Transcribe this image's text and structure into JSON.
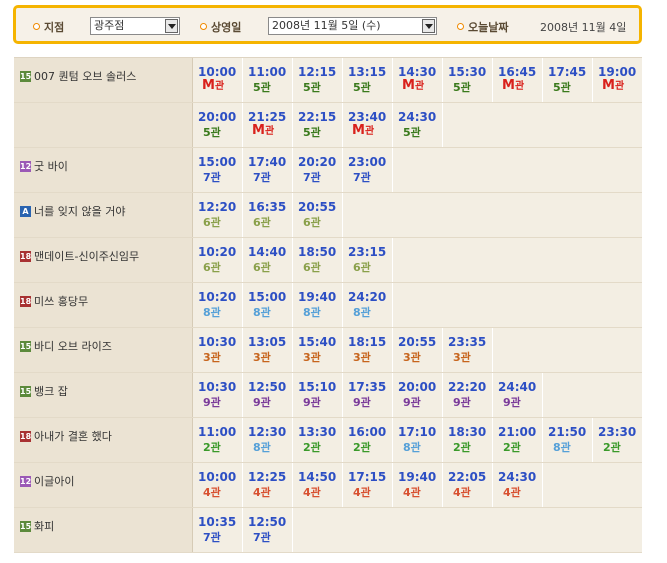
{
  "filters": {
    "branch_label": "지점",
    "branch_value": "광주점",
    "date_label": "상영일",
    "date_value": "2008년 11월 5일 (수)",
    "today_label": "오늘날짜",
    "today_value": "2008년 11월 4일"
  },
  "colors": {
    "rating_15": "#5c8a3c",
    "rating_12": "#9b59b6",
    "rating_all": "#2a64b0",
    "rating_18": "#a83232",
    "hall_M": "#d9211c",
    "hall_2": "#3a9a2a",
    "hall_3": "#c7641c",
    "hall_4": "#d85030",
    "hall_5": "#3a7a1c",
    "hall_6": "#8aa04a",
    "hall_7": "#2d4fc4",
    "hall_8": "#55a0d8",
    "hall_9": "#7a3a9a"
  },
  "hall_suffix": "관",
  "rows": [
    {
      "rating": "15",
      "title": "007 퀀텀 오브 솔러스",
      "showtimes": [
        {
          "time": "10:00",
          "hall": "M"
        },
        {
          "time": "11:00",
          "hall": "5"
        },
        {
          "time": "12:15",
          "hall": "5"
        },
        {
          "time": "13:15",
          "hall": "5"
        },
        {
          "time": "14:30",
          "hall": "M"
        },
        {
          "time": "15:30",
          "hall": "5"
        },
        {
          "time": "16:45",
          "hall": "M"
        },
        {
          "time": "17:45",
          "hall": "5"
        },
        {
          "time": "19:00",
          "hall": "M"
        }
      ]
    },
    {
      "rating": "",
      "title": "",
      "showtimes": [
        {
          "time": "20:00",
          "hall": "5"
        },
        {
          "time": "21:25",
          "hall": "M"
        },
        {
          "time": "22:15",
          "hall": "5"
        },
        {
          "time": "23:40",
          "hall": "M"
        },
        {
          "time": "24:30",
          "hall": "5"
        }
      ]
    },
    {
      "rating": "12",
      "title": "굿 바이",
      "showtimes": [
        {
          "time": "15:00",
          "hall": "7"
        },
        {
          "time": "17:40",
          "hall": "7"
        },
        {
          "time": "20:20",
          "hall": "7"
        },
        {
          "time": "23:00",
          "hall": "7"
        }
      ]
    },
    {
      "rating": "A",
      "title": "너를 잊지 않을 거야",
      "showtimes": [
        {
          "time": "12:20",
          "hall": "6"
        },
        {
          "time": "16:35",
          "hall": "6"
        },
        {
          "time": "20:55",
          "hall": "6"
        }
      ]
    },
    {
      "rating": "18",
      "title": "맨데이트-신이주신임무",
      "showtimes": [
        {
          "time": "10:20",
          "hall": "6"
        },
        {
          "time": "14:40",
          "hall": "6"
        },
        {
          "time": "18:50",
          "hall": "6"
        },
        {
          "time": "23:15",
          "hall": "6"
        }
      ]
    },
    {
      "rating": "18",
      "title": "미쓰 홍당무",
      "showtimes": [
        {
          "time": "10:20",
          "hall": "8"
        },
        {
          "time": "15:00",
          "hall": "8"
        },
        {
          "time": "19:40",
          "hall": "8"
        },
        {
          "time": "24:20",
          "hall": "8"
        }
      ]
    },
    {
      "rating": "15",
      "title": "바디 오브 라이즈",
      "showtimes": [
        {
          "time": "10:30",
          "hall": "3"
        },
        {
          "time": "13:05",
          "hall": "3"
        },
        {
          "time": "15:40",
          "hall": "3"
        },
        {
          "time": "18:15",
          "hall": "3"
        },
        {
          "time": "20:55",
          "hall": "3"
        },
        {
          "time": "23:35",
          "hall": "3"
        }
      ]
    },
    {
      "rating": "15",
      "title": "뱅크 잡",
      "showtimes": [
        {
          "time": "10:30",
          "hall": "9"
        },
        {
          "time": "12:50",
          "hall": "9"
        },
        {
          "time": "15:10",
          "hall": "9"
        },
        {
          "time": "17:35",
          "hall": "9"
        },
        {
          "time": "20:00",
          "hall": "9"
        },
        {
          "time": "22:20",
          "hall": "9"
        },
        {
          "time": "24:40",
          "hall": "9"
        }
      ]
    },
    {
      "rating": "18",
      "title": "아내가 결혼 했다",
      "showtimes": [
        {
          "time": "11:00",
          "hall": "2"
        },
        {
          "time": "12:30",
          "hall": "8"
        },
        {
          "time": "13:30",
          "hall": "2"
        },
        {
          "time": "16:00",
          "hall": "2"
        },
        {
          "time": "17:10",
          "hall": "8"
        },
        {
          "time": "18:30",
          "hall": "2"
        },
        {
          "time": "21:00",
          "hall": "2"
        },
        {
          "time": "21:50",
          "hall": "8"
        },
        {
          "time": "23:30",
          "hall": "2"
        }
      ]
    },
    {
      "rating": "12",
      "title": "이글아이",
      "showtimes": [
        {
          "time": "10:00",
          "hall": "4"
        },
        {
          "time": "12:25",
          "hall": "4"
        },
        {
          "time": "14:50",
          "hall": "4"
        },
        {
          "time": "17:15",
          "hall": "4"
        },
        {
          "time": "19:40",
          "hall": "4"
        },
        {
          "time": "22:05",
          "hall": "4"
        },
        {
          "time": "24:30",
          "hall": "4"
        }
      ]
    },
    {
      "rating": "15",
      "title": "화피",
      "showtimes": [
        {
          "time": "10:35",
          "hall": "7"
        },
        {
          "time": "12:50",
          "hall": "7"
        }
      ]
    }
  ]
}
